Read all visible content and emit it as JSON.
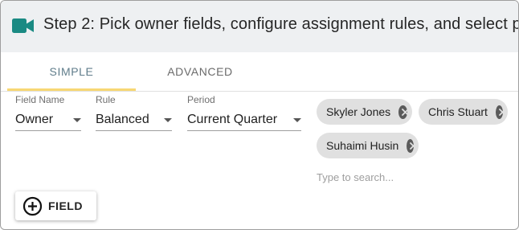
{
  "header": {
    "title": "Step 2: Pick owner fields, configure assignment rules, and select p",
    "icon": "video-camera-icon",
    "icon_color": "#1a8a83"
  },
  "tabs": [
    {
      "label": "SIMPLE",
      "active": true
    },
    {
      "label": "ADVANCED",
      "active": false
    }
  ],
  "tab_indicator_color": "#f7d774",
  "fields": {
    "field_name": {
      "label": "Field Name",
      "value": "Owner"
    },
    "rule": {
      "label": "Rule",
      "value": "Balanced"
    },
    "period": {
      "label": "Period",
      "value": "Current Quarter"
    }
  },
  "chips": [
    {
      "label": "Skyler Jones"
    },
    {
      "label": "Chris Stuart"
    },
    {
      "label": "Suhaimi Husin"
    }
  ],
  "search": {
    "placeholder": "Type to search...",
    "value": ""
  },
  "add_button": {
    "label": "FIELD",
    "icon": "add-circle-icon"
  }
}
